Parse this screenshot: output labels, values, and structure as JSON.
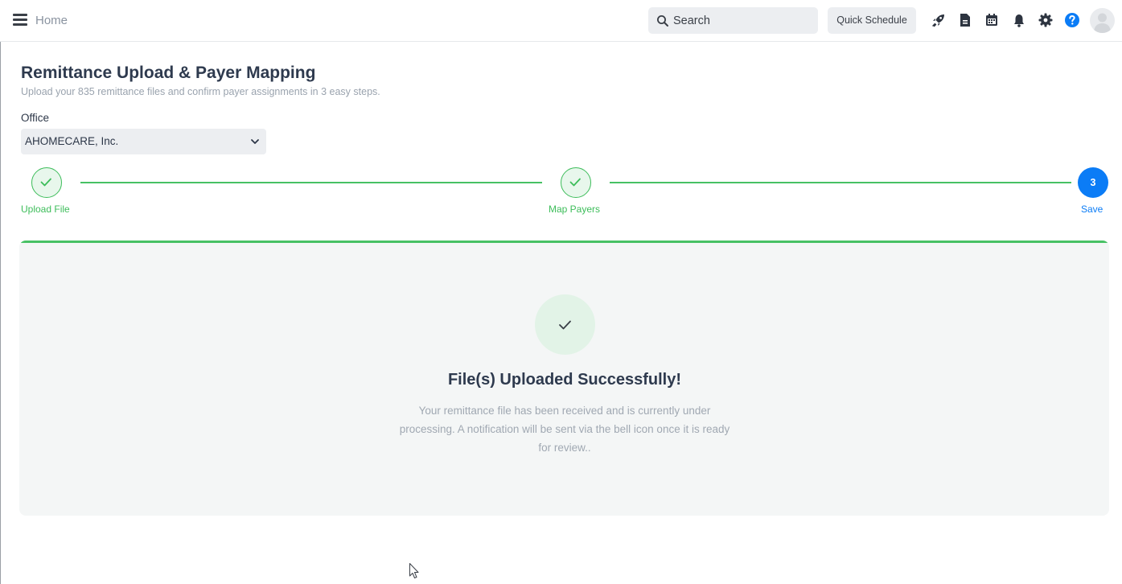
{
  "topbar": {
    "home_label": "Home",
    "search_placeholder": "Search",
    "quick_schedule_label": "Quick Schedule",
    "icons": [
      "rocket-icon",
      "document-icon",
      "calendar-icon",
      "bell-icon",
      "gear-icon",
      "help-icon"
    ],
    "help_color": "#0b7cf6"
  },
  "page": {
    "title": "Remittance Upload & Payer Mapping",
    "subtitle": "Upload your 835 remittance files and confirm payer assignments in 3 easy steps."
  },
  "office": {
    "label": "Office",
    "selected": "AHOMECARE, Inc."
  },
  "stepper": {
    "steps": [
      {
        "label": "Upload File",
        "state": "complete"
      },
      {
        "label": "Map Payers",
        "state": "complete"
      },
      {
        "label": "Save",
        "state": "current",
        "number": "3"
      }
    ],
    "complete_color": "#3dbd5a",
    "current_color": "#0b7cf6"
  },
  "result": {
    "title": "File(s) Uploaded Successfully!",
    "message_line1": "Your remittance file has been received and is currently under",
    "message_line2": "processing. A notification will be sent via the bell icon once it is ready",
    "message_line3": "for review.."
  }
}
